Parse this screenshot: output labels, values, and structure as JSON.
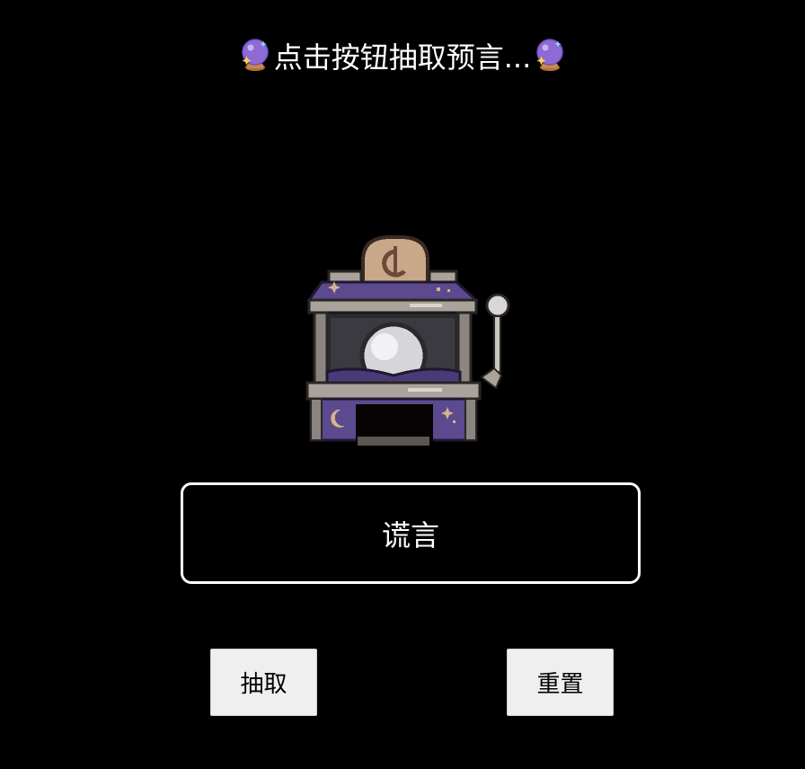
{
  "header": {
    "title": "点击按钮抽取预言...",
    "left_icon": "crystal-ball-icon",
    "right_icon": "crystal-ball-icon"
  },
  "machine": {
    "icon": "fortune-slot-machine-icon"
  },
  "result": {
    "text": "谎言"
  },
  "buttons": {
    "draw_label": "抽取",
    "reset_label": "重置"
  },
  "colors": {
    "background": "#000000",
    "text": "#ffffff",
    "machine_purple": "#5b4a8e",
    "machine_stone": "#8a8580",
    "coin_tan": "#c9a88a",
    "button_bg": "#efefef"
  }
}
